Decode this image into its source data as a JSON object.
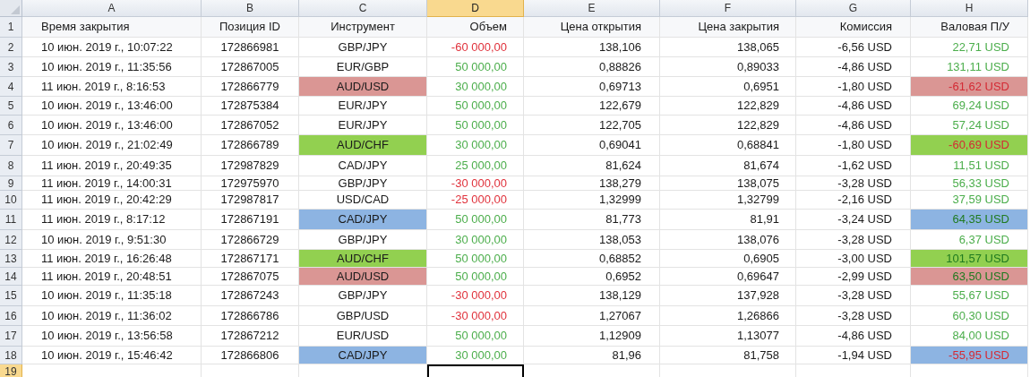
{
  "columns": [
    {
      "letter": "A",
      "selected": false
    },
    {
      "letter": "B",
      "selected": false
    },
    {
      "letter": "C",
      "selected": false
    },
    {
      "letter": "D",
      "selected": true
    },
    {
      "letter": "E",
      "selected": false
    },
    {
      "letter": "F",
      "selected": false
    },
    {
      "letter": "G",
      "selected": false
    },
    {
      "letter": "H",
      "selected": false
    }
  ],
  "header_row": {
    "number": "1",
    "cells": [
      "Время закрытия",
      "Позиция ID",
      "Инструмент",
      "Объем",
      "Цена открытия",
      "Цена закрытия",
      "Комиссия",
      "Валовая П/У"
    ]
  },
  "rows": [
    {
      "number": "2",
      "cells": [
        {
          "text": "10 июн. 2019 г., 10:07:22"
        },
        {
          "text": "172866981"
        },
        {
          "text": "GBP/JPY"
        },
        {
          "text": "-60 000,00",
          "negative": true
        },
        {
          "text": "138,106"
        },
        {
          "text": "138,065"
        },
        {
          "text": "-6,56 USD"
        },
        {
          "text": "22,71 USD",
          "negative": false
        }
      ]
    },
    {
      "number": "3",
      "cells": [
        {
          "text": "10 июн. 2019 г., 11:35:56"
        },
        {
          "text": "172867005"
        },
        {
          "text": "EUR/GBP"
        },
        {
          "text": "50 000,00",
          "negative": false
        },
        {
          "text": "0,88826"
        },
        {
          "text": "0,89033"
        },
        {
          "text": "-4,86 USD"
        },
        {
          "text": "131,11 USD",
          "negative": false
        }
      ]
    },
    {
      "number": "4",
      "cells": [
        {
          "text": "11 июн. 2019 г., 8:16:53"
        },
        {
          "text": "172866779"
        },
        {
          "text": "AUD/USD",
          "color": "#da9694"
        },
        {
          "text": "30 000,00",
          "negative": false
        },
        {
          "text": "0,69713"
        },
        {
          "text": "0,6951"
        },
        {
          "text": "-1,80 USD"
        },
        {
          "text": "-61,62 USD",
          "negative": true,
          "color": "#da9694"
        }
      ]
    },
    {
      "number": "5",
      "cells": [
        {
          "text": "10 июн. 2019 г., 13:46:00"
        },
        {
          "text": "172875384"
        },
        {
          "text": "EUR/JPY"
        },
        {
          "text": "50 000,00",
          "negative": false
        },
        {
          "text": "122,679"
        },
        {
          "text": "122,829"
        },
        {
          "text": "-4,86 USD"
        },
        {
          "text": "69,24 USD",
          "negative": false
        }
      ]
    },
    {
      "number": "6",
      "cells": [
        {
          "text": "10 июн. 2019 г., 13:46:00"
        },
        {
          "text": "172867052"
        },
        {
          "text": "EUR/JPY"
        },
        {
          "text": "50 000,00",
          "negative": false
        },
        {
          "text": "122,705"
        },
        {
          "text": "122,829"
        },
        {
          "text": "-4,86 USD"
        },
        {
          "text": "57,24 USD",
          "negative": false
        }
      ]
    },
    {
      "number": "7",
      "cells": [
        {
          "text": "10 июн. 2019 г., 21:02:49"
        },
        {
          "text": "172866789"
        },
        {
          "text": "AUD/CHF",
          "color": "#92d050"
        },
        {
          "text": "30 000,00",
          "negative": false
        },
        {
          "text": "0,69041"
        },
        {
          "text": "0,68841"
        },
        {
          "text": "-1,80 USD"
        },
        {
          "text": "-60,69 USD",
          "negative": true,
          "color": "#92d050"
        }
      ]
    },
    {
      "number": "8",
      "cells": [
        {
          "text": "11 июн. 2019 г., 20:49:35"
        },
        {
          "text": "172987829"
        },
        {
          "text": "CAD/JPY"
        },
        {
          "text": "25 000,00",
          "negative": false
        },
        {
          "text": "81,624"
        },
        {
          "text": "81,674"
        },
        {
          "text": "-1,62 USD"
        },
        {
          "text": "11,51 USD",
          "negative": false
        }
      ]
    },
    {
      "number": "9",
      "cells": [
        {
          "text": "11 июн. 2019 г., 14:00:31"
        },
        {
          "text": "172975970"
        },
        {
          "text": "GBP/JPY"
        },
        {
          "text": "-30 000,00",
          "negative": true
        },
        {
          "text": "138,279"
        },
        {
          "text": "138,075"
        },
        {
          "text": "-3,28 USD"
        },
        {
          "text": "56,33 USD",
          "negative": false
        }
      ]
    },
    {
      "number": "10",
      "cells": [
        {
          "text": "11 июн. 2019 г., 20:42:29"
        },
        {
          "text": "172987817"
        },
        {
          "text": "USD/CAD"
        },
        {
          "text": "-25 000,00",
          "negative": true
        },
        {
          "text": "1,32999"
        },
        {
          "text": "1,32799"
        },
        {
          "text": "-2,16 USD"
        },
        {
          "text": "37,59 USD",
          "negative": false
        }
      ]
    },
    {
      "number": "11",
      "cells": [
        {
          "text": "11 июн. 2019 г., 8:17:12"
        },
        {
          "text": "172867191"
        },
        {
          "text": "CAD/JPY",
          "color": "#8db4e2"
        },
        {
          "text": "50 000,00",
          "negative": false
        },
        {
          "text": "81,773"
        },
        {
          "text": "81,91"
        },
        {
          "text": "-3,24 USD"
        },
        {
          "text": "64,35 USD",
          "negative": false,
          "color": "#8db4e2"
        }
      ]
    },
    {
      "number": "12",
      "cells": [
        {
          "text": "10 июн. 2019 г., 9:51:30"
        },
        {
          "text": "172866729"
        },
        {
          "text": "GBP/JPY"
        },
        {
          "text": "30 000,00",
          "negative": false
        },
        {
          "text": "138,053"
        },
        {
          "text": "138,076"
        },
        {
          "text": "-3,28 USD"
        },
        {
          "text": "6,37 USD",
          "negative": false
        }
      ]
    },
    {
      "number": "13",
      "cells": [
        {
          "text": "11 июн. 2019 г., 16:26:48"
        },
        {
          "text": "172867171"
        },
        {
          "text": "AUD/CHF",
          "color": "#92d050"
        },
        {
          "text": "50 000,00",
          "negative": false
        },
        {
          "text": "0,68852"
        },
        {
          "text": "0,6905"
        },
        {
          "text": "-3,00 USD"
        },
        {
          "text": "101,57 USD",
          "negative": false,
          "color": "#92d050"
        }
      ]
    },
    {
      "number": "14",
      "cells": [
        {
          "text": "11 июн. 2019 г., 20:48:51"
        },
        {
          "text": "172867075"
        },
        {
          "text": "AUD/USD",
          "color": "#da9694"
        },
        {
          "text": "50 000,00",
          "negative": false
        },
        {
          "text": "0,6952"
        },
        {
          "text": "0,69647"
        },
        {
          "text": "-2,99 USD"
        },
        {
          "text": "63,50 USD",
          "negative": false,
          "color": "#da9694"
        }
      ]
    },
    {
      "number": "15",
      "cells": [
        {
          "text": "10 июн. 2019 г., 11:35:18"
        },
        {
          "text": "172867243"
        },
        {
          "text": "GBP/JPY"
        },
        {
          "text": "-30 000,00",
          "negative": true
        },
        {
          "text": "138,129"
        },
        {
          "text": "137,928"
        },
        {
          "text": "-3,28 USD"
        },
        {
          "text": "55,67 USD",
          "negative": false
        }
      ]
    },
    {
      "number": "16",
      "cells": [
        {
          "text": "10 июн. 2019 г., 11:36:02"
        },
        {
          "text": "172866786"
        },
        {
          "text": "GBP/USD"
        },
        {
          "text": "-30 000,00",
          "negative": true
        },
        {
          "text": "1,27067"
        },
        {
          "text": "1,26866"
        },
        {
          "text": "-3,28 USD"
        },
        {
          "text": "60,30 USD",
          "negative": false
        }
      ]
    },
    {
      "number": "17",
      "cells": [
        {
          "text": "10 июн. 2019 г., 13:56:58"
        },
        {
          "text": "172867212"
        },
        {
          "text": "EUR/USD"
        },
        {
          "text": "50 000,00",
          "negative": false
        },
        {
          "text": "1,12909"
        },
        {
          "text": "1,13077"
        },
        {
          "text": "-4,86 USD"
        },
        {
          "text": "84,00 USD",
          "negative": false
        }
      ]
    },
    {
      "number": "18",
      "cells": [
        {
          "text": "10 июн. 2019 г., 15:46:42"
        },
        {
          "text": "172866806"
        },
        {
          "text": "CAD/JPY",
          "color": "#8db4e2"
        },
        {
          "text": "30 000,00",
          "negative": false
        },
        {
          "text": "81,96"
        },
        {
          "text": "81,758"
        },
        {
          "text": "-1,94 USD"
        },
        {
          "text": "-55,95 USD",
          "negative": true,
          "color": "#8db4e2"
        }
      ]
    }
  ],
  "empty_row": {
    "number": "19",
    "selected": true
  }
}
